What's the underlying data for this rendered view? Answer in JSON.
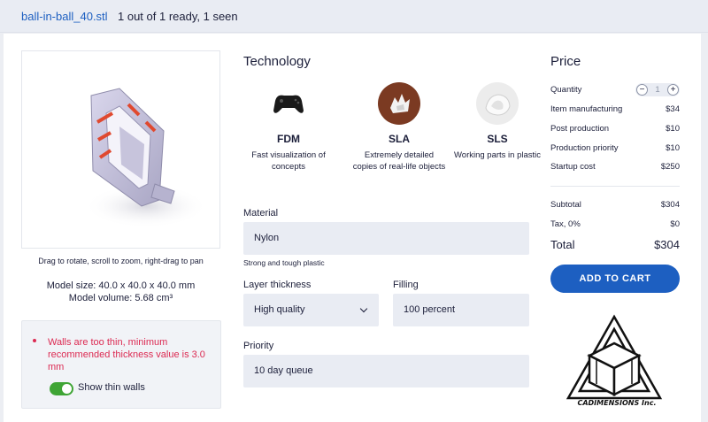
{
  "header": {
    "file_name": "ball-in-ball_40.stl",
    "status": "1 out of 1 ready, 1 seen"
  },
  "viewer": {
    "hint": "Drag to rotate, scroll to zoom, right-drag to pan",
    "model_size": "Model size: 40.0 x 40.0 x 40.0 mm",
    "model_volume": "Model volume: 5.68 cm³"
  },
  "warning": {
    "text": "Walls are too thin, minimum recommended thickness value is 3.0 mm",
    "toggle_label": "Show thin walls",
    "toggle_on": true
  },
  "technology": {
    "title": "Technology",
    "options": [
      {
        "name": "FDM",
        "desc": "Fast visualization of concepts",
        "icon": "gamepad-icon"
      },
      {
        "name": "SLA",
        "desc": "Extremely detailed copies of real-life objects",
        "icon": "sla-part-icon"
      },
      {
        "name": "SLS",
        "desc": "Working parts in plastic",
        "icon": "sls-part-icon"
      }
    ]
  },
  "material": {
    "label": "Material",
    "value": "Nylon",
    "note": "Strong and tough plastic"
  },
  "layer_thickness": {
    "label": "Layer thickness",
    "value": "High quality"
  },
  "filling": {
    "label": "Filling",
    "value": "100 percent"
  },
  "priority": {
    "label": "Priority",
    "value": "10 day queue"
  },
  "price": {
    "title": "Price",
    "quantity_label": "Quantity",
    "quantity": "1",
    "rows": [
      {
        "label": "Item manufacturing",
        "value": "$34"
      },
      {
        "label": "Post production",
        "value": "$10"
      },
      {
        "label": "Production priority",
        "value": "$10"
      },
      {
        "label": "Startup cost",
        "value": "$250"
      }
    ],
    "subtotal_label": "Subtotal",
    "subtotal": "$304",
    "tax_label": "Tax, 0%",
    "tax": "$0",
    "total_label": "Total",
    "total": "$304",
    "cart_button": "ADD TO CART"
  },
  "logo": {
    "text": "CADIMENSIONS Inc."
  },
  "colors": {
    "accent": "#1d5fc1",
    "warning": "#dc2a52",
    "toggle": "#3fa535"
  }
}
